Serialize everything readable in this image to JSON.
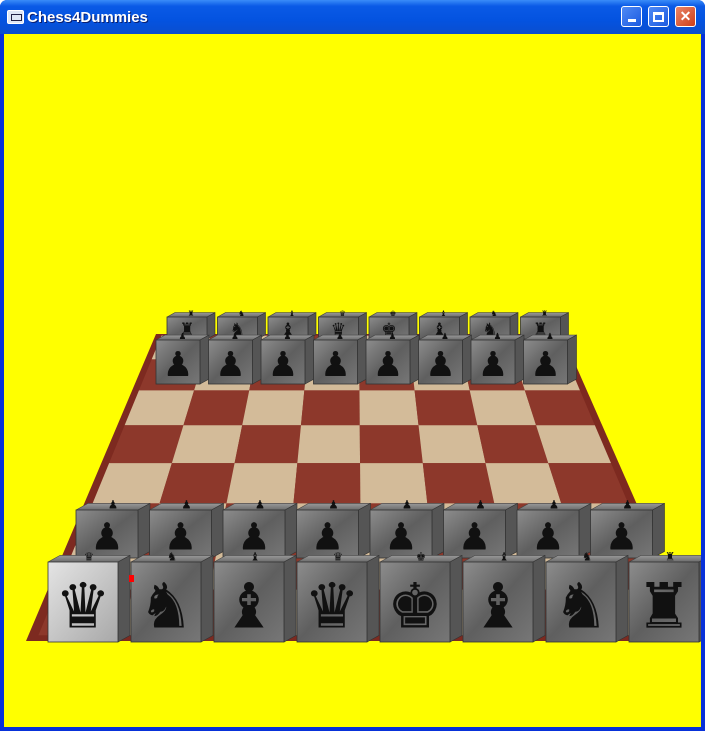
{
  "window": {
    "title": "Chess4Dummies",
    "icon": "app-window-icon",
    "controls": {
      "minimize": {
        "icon": "minimize-icon"
      },
      "maximize": {
        "icon": "maximize-icon"
      },
      "close": {
        "icon": "close-icon",
        "glyph": "✕"
      }
    }
  },
  "scene": {
    "background_color": "#ffff00",
    "board": {
      "files": 8,
      "ranks": 8,
      "light_square_color": "#d8c3a0",
      "dark_square_color": "#8f3a2c",
      "frame_color": "#7d2a20"
    },
    "pieces": {
      "back_row": [
        {
          "piece": "queen",
          "glyph": "♛",
          "selected": true
        },
        {
          "piece": "knight",
          "glyph": "♞"
        },
        {
          "piece": "bishop",
          "glyph": "♝"
        },
        {
          "piece": "queen",
          "glyph": "♛"
        },
        {
          "piece": "king",
          "glyph": "♚"
        },
        {
          "piece": "bishop",
          "glyph": "♝"
        },
        {
          "piece": "knight",
          "glyph": "♞"
        },
        {
          "piece": "rook",
          "glyph": "♜"
        }
      ],
      "pawn_row": [
        "♟",
        "♟",
        "♟",
        "♟",
        "♟",
        "♟",
        "♟",
        "♟"
      ],
      "far_back_row": [
        "♜",
        "♞",
        "♝",
        "♛",
        "♚",
        "♝",
        "♞",
        "♜"
      ],
      "far_pawn_row": [
        "♟",
        "♟",
        "♟",
        "♟",
        "♟",
        "♟",
        "♟",
        "♟"
      ]
    }
  }
}
